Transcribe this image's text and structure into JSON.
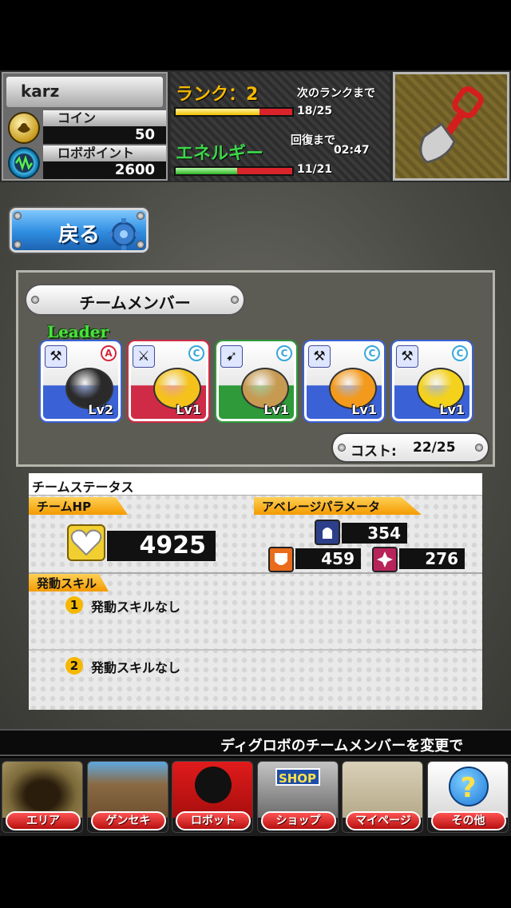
{
  "header": {
    "username": "karz",
    "coin_label": "コイン",
    "coin_value": "50",
    "robo_point_label": "ロボポイント",
    "robo_point_value": "2600",
    "rank_label": "ランク：2",
    "next_rank_label": "次のランクまで",
    "rank_progress_text": "18/25",
    "rank_progress": 0.72,
    "energy_label": "エネルギー",
    "recovery_label": "回復まで",
    "recovery_time": "02:47",
    "energy_progress_text": "11/21",
    "energy_progress": 0.524
  },
  "back_button": {
    "label": "戻る"
  },
  "team": {
    "title": "チームメンバー",
    "leader_label": "Leader",
    "members": [
      {
        "level": "Lv2",
        "weapon_icon": "axe-icon",
        "type_mark": "A",
        "bg": "#3a62d6"
      },
      {
        "level": "Lv1",
        "weapon_icon": "sword-icon",
        "type_mark": "C",
        "bg": "#cf2b46"
      },
      {
        "level": "Lv1",
        "weapon_icon": "gun-icon",
        "type_mark": "C",
        "bg": "#2e9a3a"
      },
      {
        "level": "Lv1",
        "weapon_icon": "axe-icon",
        "type_mark": "C",
        "bg": "#3a62d6"
      },
      {
        "level": "Lv1",
        "weapon_icon": "axe-icon",
        "type_mark": "C",
        "bg": "#3a62d6"
      }
    ],
    "cost_label": "コスト:",
    "cost_value": "22/25"
  },
  "status": {
    "title": "チームステータス",
    "hp_label": "チームHP",
    "hp_value": "4925",
    "avg_label": "アベレージパラメータ",
    "param_top": "354",
    "param_left": "459",
    "param_right": "276",
    "skill_label": "発動スキル",
    "skills": [
      {
        "num": "1",
        "text": "発動スキルなし"
      },
      {
        "num": "2",
        "text": "発動スキルなし"
      }
    ]
  },
  "ticker": {
    "text": "ディグロボのチームメンバーを変更で"
  },
  "nav": [
    {
      "label": "エリア",
      "icon": "cave-icon"
    },
    {
      "label": "ゲンセキ",
      "icon": "ore-icon"
    },
    {
      "label": "ロボット",
      "icon": "robot-icon"
    },
    {
      "label": "ショップ",
      "icon": "shop-icon",
      "sign": "SHOP"
    },
    {
      "label": "マイページ",
      "icon": "book-icon"
    },
    {
      "label": "その他",
      "icon": "question-icon",
      "mark": "?"
    }
  ],
  "colors": {
    "rank_gold": "#f5b800",
    "energy_green": "#3cd64a",
    "bar_red": "#d8242a",
    "nav_label_red": "#c41414",
    "back_blue": "#2f8de0"
  }
}
